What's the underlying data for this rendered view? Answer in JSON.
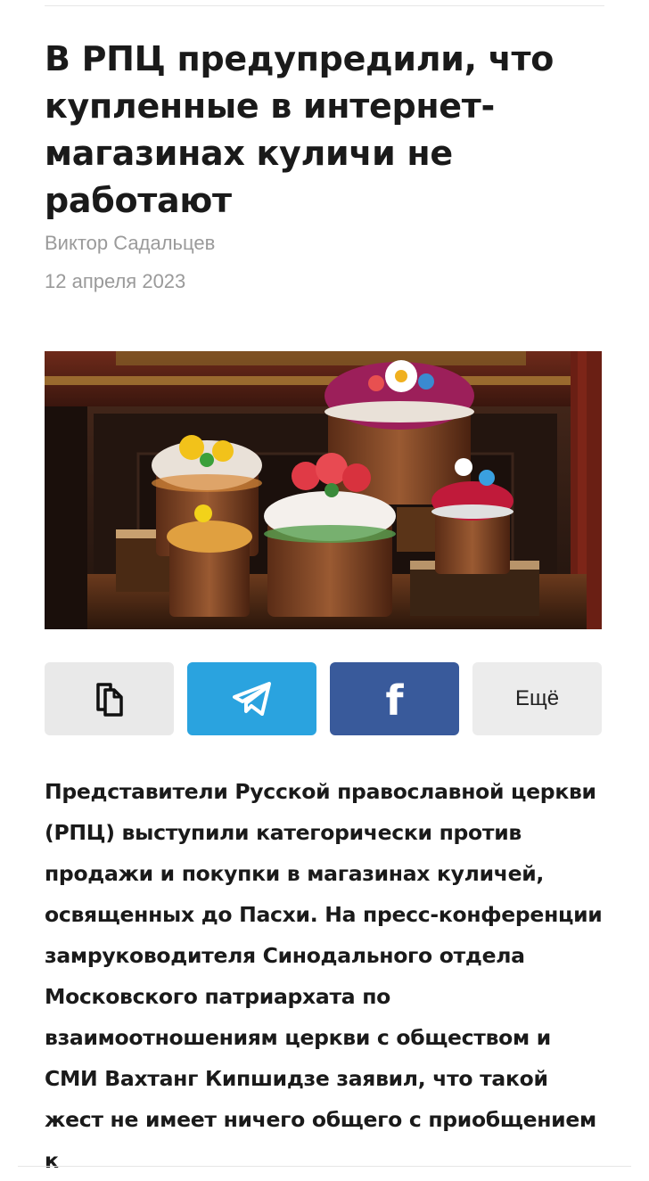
{
  "article": {
    "title": "В РПЦ предупредили, что купленные в интернет-магазинах куличи не работают",
    "author": "Виктор Садальцев",
    "date": "12 апреля 2023",
    "body": "Представители Русской православной церкви (РПЦ) выступили категорически против продажи и покупки в магазинах куличей, освященных до Пасхи. На пресс-конференции замруководителя Синодального отдела Московского патриархата по взаимоотношениям церкви с обществом и СМИ Вахтанг Кипшидзе заявил, что такой жест не имеет ничего общего с приобщением к"
  },
  "share": {
    "copy_icon": "copy-icon",
    "telegram_icon": "telegram-icon",
    "facebook_label": "f",
    "more_label": "Ещё"
  },
  "colors": {
    "telegram": "#2aa3df",
    "facebook": "#395a9b",
    "neutral_button": "#e9e9e9",
    "meta_text": "#9a9a9a"
  }
}
